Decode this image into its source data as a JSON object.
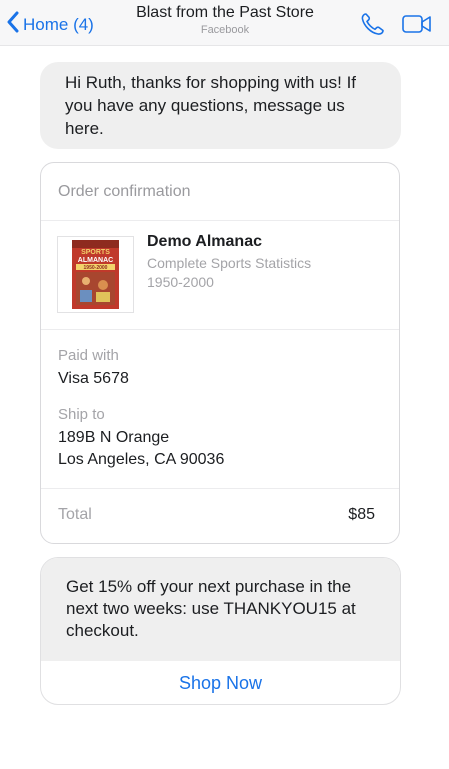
{
  "header": {
    "back_label": "Home (4)",
    "title": "Blast from the Past Store",
    "subtitle": "Facebook",
    "back_icon": "chevron-left-icon",
    "call_icon": "phone-icon",
    "video_icon": "video-camera-icon",
    "accent_color": "#1a73e8"
  },
  "messages": {
    "greeting": "Hi Ruth, thanks for shopping with us! If you have any questions, message us here."
  },
  "order": {
    "header": "Order confirmation",
    "item": {
      "title": "Demo Almanac",
      "subtitle": "Complete Sports Statistics 1950-2000",
      "cover_text_line1": "SPORTS",
      "cover_text_line2": "ALMANAC",
      "cover_years": "1950-2000"
    },
    "paid_label": "Paid with",
    "paid_value": "Visa 5678",
    "ship_label": "Ship to",
    "ship_line1": "189B N Orange",
    "ship_line2": "Los Angeles, CA 90036",
    "total_label": "Total",
    "total_value": "$85"
  },
  "promo": {
    "text": "Get 15% off your next purchase in the next two weeks: use THANKYOU15 at checkout.",
    "button_label": "Shop Now"
  }
}
